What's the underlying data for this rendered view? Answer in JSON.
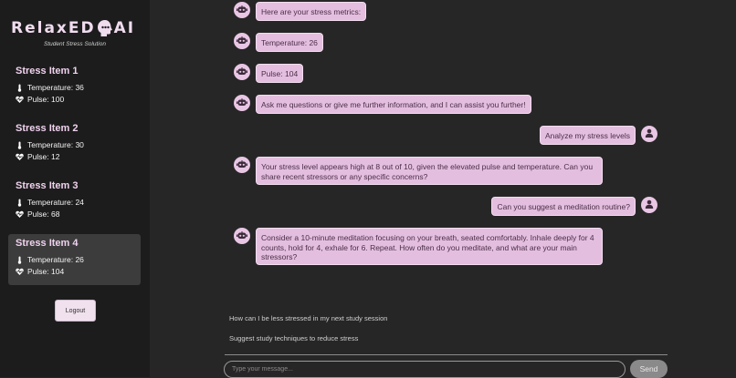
{
  "app": {
    "logo_text_left": "RelaxED",
    "logo_text_right": "AI",
    "tagline": "Student Stress Solution"
  },
  "sidebar": {
    "items": [
      {
        "title": "Stress Item 1",
        "temperature": "Temperature: 36",
        "pulse": "Pulse: 100"
      },
      {
        "title": "Stress Item 2",
        "temperature": "Temperature: 30",
        "pulse": "Pulse: 12"
      },
      {
        "title": "Stress Item 3",
        "temperature": "Temperature: 24",
        "pulse": "Pulse: 68"
      },
      {
        "title": "Stress Item 4",
        "temperature": "Temperature: 26",
        "pulse": "Pulse: 104"
      }
    ],
    "active_index": 3,
    "logout_label": "Logout"
  },
  "chat": {
    "messages": [
      {
        "from": "bot",
        "text": "Here are your stress metrics:"
      },
      {
        "from": "bot",
        "text": "Temperature: 26"
      },
      {
        "from": "bot",
        "text": "Pulse: 104"
      },
      {
        "from": "bot",
        "text": "Ask me questions or give me further information, and I can assist you further!"
      },
      {
        "from": "user",
        "text": "Analyze my stress levels"
      },
      {
        "from": "bot",
        "text": "Your stress level appears high at 8 out of 10, given the elevated pulse and temperature. Can you share recent stressors or any specific concerns?"
      },
      {
        "from": "user",
        "text": "Can you suggest a meditation routine?"
      },
      {
        "from": "bot",
        "text": "Consider a 10-minute meditation focusing on your breath, seated comfortably. Inhale deeply for 4 counts, hold for 4, exhale for 6. Repeat. How often do you meditate, and what are your main stressors?"
      }
    ],
    "suggestions": [
      "How can I be less stressed in my next study session",
      "Suggest study techniques to reduce stress"
    ],
    "input_placeholder": "Type your message...",
    "send_label": "Send"
  },
  "colors": {
    "accent": "#e4bedf",
    "sidebar_bg": "#1c1c1c",
    "main_bg": "#262626"
  }
}
